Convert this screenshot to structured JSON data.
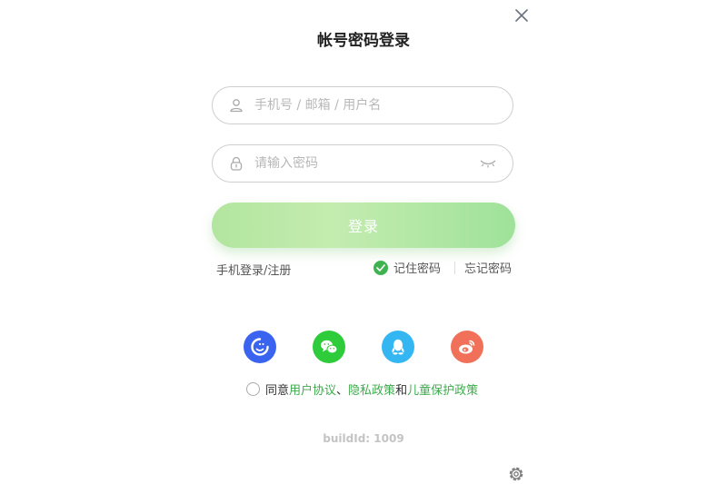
{
  "title": "帐号密码登录",
  "account": {
    "placeholder": "手机号 / 邮箱 / 用户名",
    "value": ""
  },
  "password": {
    "placeholder": "请输入密码",
    "value": ""
  },
  "login_button": "登录",
  "phone_login": "手机登录/注册",
  "remember_password": "记住密码",
  "forgot_password": "忘记密码",
  "social_login": [
    {
      "name": "passport",
      "icon": "passport-icon",
      "color": "#3a64f0"
    },
    {
      "name": "wechat",
      "icon": "wechat-icon",
      "color": "#2ecc3b"
    },
    {
      "name": "qq",
      "icon": "qq-icon",
      "color": "#33b6f2"
    },
    {
      "name": "weibo",
      "icon": "weibo-icon",
      "color": "#f0705a"
    }
  ],
  "agreement": {
    "prefix": "同意",
    "user_agreement": "用户协议",
    "sep": "、",
    "privacy_policy": "隐私政策",
    "and": "和",
    "child_policy": "儿童保护政策"
  },
  "build_id": "buildId: 1009",
  "colors": {
    "accent": "#3cab4c",
    "button_start": "#b2e59f",
    "button_end": "#9fe29a"
  }
}
